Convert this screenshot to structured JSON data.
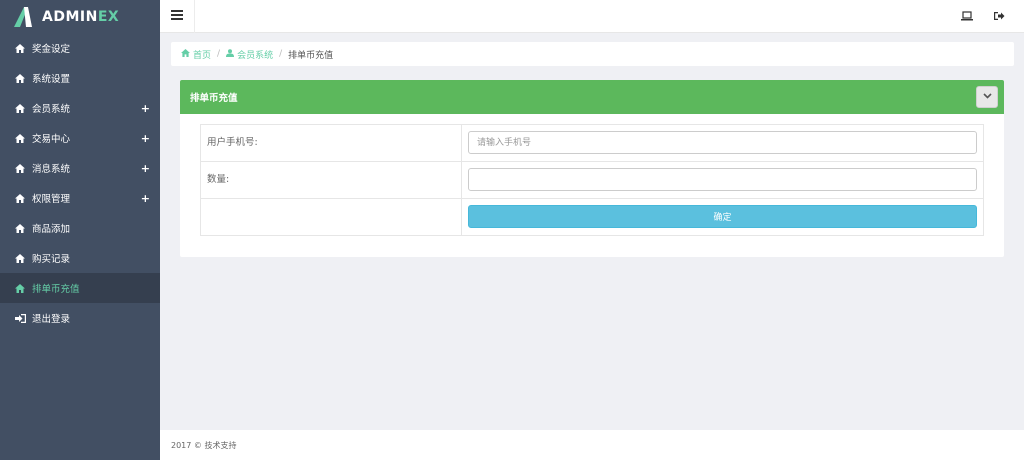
{
  "app": {
    "logo_main": "ADMIN",
    "logo_accent": "EX"
  },
  "colors": {
    "sidebar_bg": "#424f63",
    "sidebar_active_bg": "#353f4f",
    "accent": "#65cea7",
    "panel_header": "#5cb85c",
    "button_info": "#5bc0de"
  },
  "sidebar": {
    "items": [
      {
        "label": "奖金设定",
        "icon": "home-icon",
        "expandable": false,
        "active": false
      },
      {
        "label": "系统设置",
        "icon": "home-icon",
        "expandable": false,
        "active": false
      },
      {
        "label": "会员系统",
        "icon": "home-icon",
        "expandable": true,
        "active": false
      },
      {
        "label": "交易中心",
        "icon": "home-icon",
        "expandable": true,
        "active": false
      },
      {
        "label": "消息系统",
        "icon": "home-icon",
        "expandable": true,
        "active": false
      },
      {
        "label": "权限管理",
        "icon": "home-icon",
        "expandable": true,
        "active": false
      },
      {
        "label": "商品添加",
        "icon": "home-icon",
        "expandable": false,
        "active": false
      },
      {
        "label": "购买记录",
        "icon": "home-icon",
        "expandable": false,
        "active": false
      },
      {
        "label": "排单币充值",
        "icon": "home-icon",
        "expandable": false,
        "active": true
      },
      {
        "label": "退出登录",
        "icon": "sign-in-icon",
        "expandable": false,
        "active": false
      }
    ],
    "expand_symbol": "+"
  },
  "header": {
    "toggle_icon": "hamburger-icon",
    "right_icons": [
      "laptop-icon",
      "sign-out-icon"
    ]
  },
  "breadcrumb": {
    "items": [
      {
        "label": "首页",
        "icon": "home-icon"
      },
      {
        "label": "会员系统",
        "icon": "user-icon"
      }
    ],
    "separator": "/",
    "current": "排单币充值"
  },
  "panel": {
    "title": "排单币充值",
    "toggle_icon": "chevron-down-icon",
    "form": {
      "phone_label": "用户手机号:",
      "phone_value": "",
      "phone_placeholder": "请输入手机号",
      "amount_label": "数量:",
      "amount_value": "",
      "amount_placeholder": "",
      "submit_label": "确定"
    }
  },
  "footer": {
    "text": "2017 © 技术支持"
  }
}
